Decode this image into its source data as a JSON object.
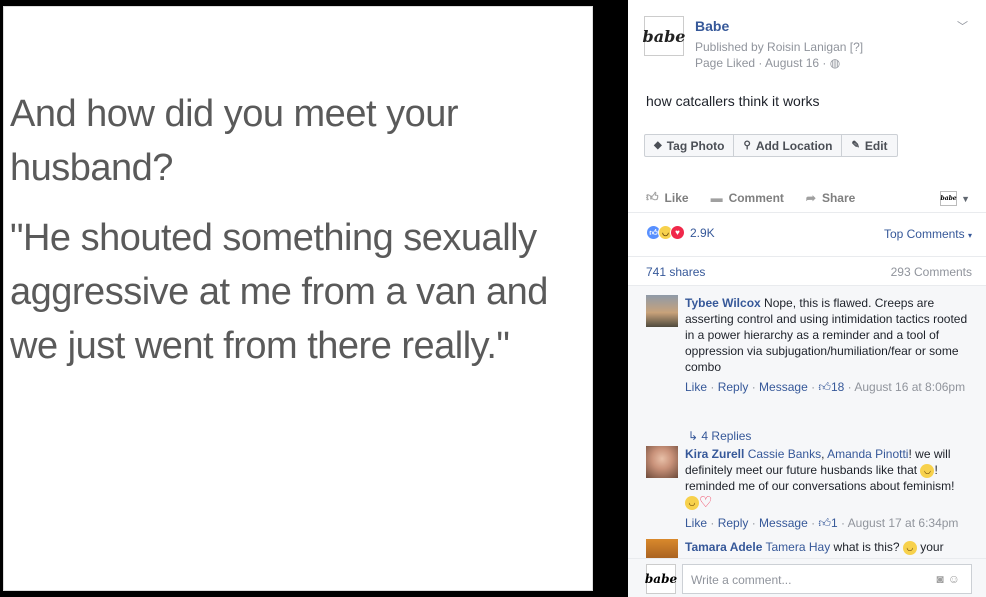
{
  "photo": {
    "lines": [
      "And how did you meet your",
      "husband?",
      "\"He shouted something sexually",
      "aggressive at me from a van and",
      "we just went from there really.\""
    ]
  },
  "post": {
    "logo_text": "babe",
    "page_name": "Babe",
    "published_by": "Published by Roisin Lanigan [?]",
    "meta": "Page Liked · August 16 ·",
    "caption": "how catcallers think it works",
    "actions": [
      "Tag Photo",
      "Add Location",
      "Edit"
    ],
    "bar": [
      "Like",
      "Comment",
      "Share"
    ],
    "reactions_count": "2.9K",
    "top_comments": "Top Comments",
    "shares": "741 shares",
    "comments_count": "293 Comments"
  },
  "comments": [
    {
      "name": "Tybee Wilcox",
      "text": "Nope, this is flawed. Creeps are asserting control and using intimidation tactics rooted in a power hierarchy as a reminder and a tool of oppression via subjugation/humiliation/fear or some combo",
      "like": "Like",
      "reply": "Reply",
      "message": "Message",
      "likes": "18",
      "time": "August 16 at 8:06pm",
      "replies": "4 Replies"
    },
    {
      "name": "Kira Zurell",
      "tag1": "Cassie Banks",
      "tag2": "Amanda Pinotti",
      "text1": "! we will definitely meet our future husbands like that",
      "text2": "! reminded me of our conversations about feminism!",
      "like": "Like",
      "reply": "Reply",
      "message": "Message",
      "likes": "1",
      "time": "August 17 at 6:34pm"
    },
    {
      "name": "Tamara Adele",
      "tag1": "Tamera Hay",
      "text1": "what is this?",
      "text2": "your"
    }
  ],
  "composer": {
    "placeholder": "Write a comment..."
  }
}
